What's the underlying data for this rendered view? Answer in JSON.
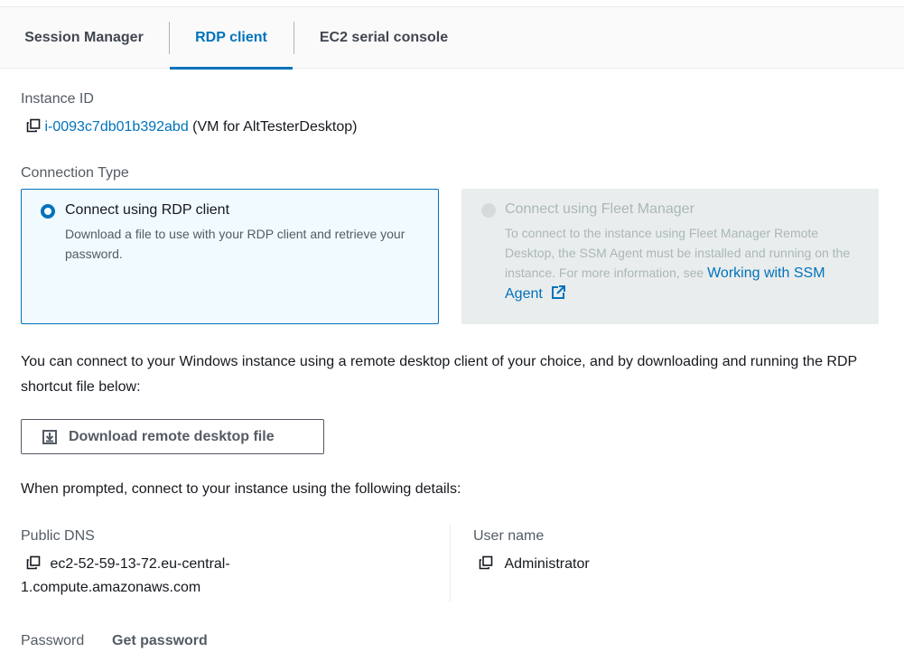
{
  "tabs": [
    {
      "label": "Session Manager",
      "active": false
    },
    {
      "label": "RDP client",
      "active": true
    },
    {
      "label": "EC2 serial console",
      "active": false
    }
  ],
  "instance": {
    "label": "Instance ID",
    "id": "i-0093c7db01b392abd",
    "name_suffix": "(VM for AltTesterDesktop)"
  },
  "connection_type": {
    "label": "Connection Type",
    "options": [
      {
        "title": "Connect using RDP client",
        "description": "Download a file to use with your RDP client and retrieve your password.",
        "selected": true,
        "disabled": false
      },
      {
        "title": "Connect using Fleet Manager",
        "description": "To connect to the instance using Fleet Manager Remote Desktop, the SSM Agent must be installed and running on the instance. For more information, see",
        "link_text": "Working with SSM Agent",
        "selected": false,
        "disabled": true
      }
    ]
  },
  "intro_text": "You can connect to your Windows instance using a remote desktop client of your choice, and by downloading and running the RDP shortcut file below:",
  "download_button": {
    "label": "Download remote desktop file",
    "icon": "download-icon"
  },
  "prompt_text": "When prompted, connect to your instance using the following details:",
  "details": {
    "public_dns_label": "Public DNS",
    "public_dns_line1": "ec2-52-59-13-72.eu-central-",
    "public_dns_line2": "1.compute.amazonaws.com",
    "user_name_label": "User name",
    "user_name": "Administrator",
    "password_label": "Password",
    "get_password_label": "Get password"
  },
  "colors": {
    "accent": "#0073bb",
    "selected_card_bg": "#f1faff",
    "disabled_card_bg": "#eaeded",
    "text": "#16191f",
    "muted": "#545b64"
  }
}
